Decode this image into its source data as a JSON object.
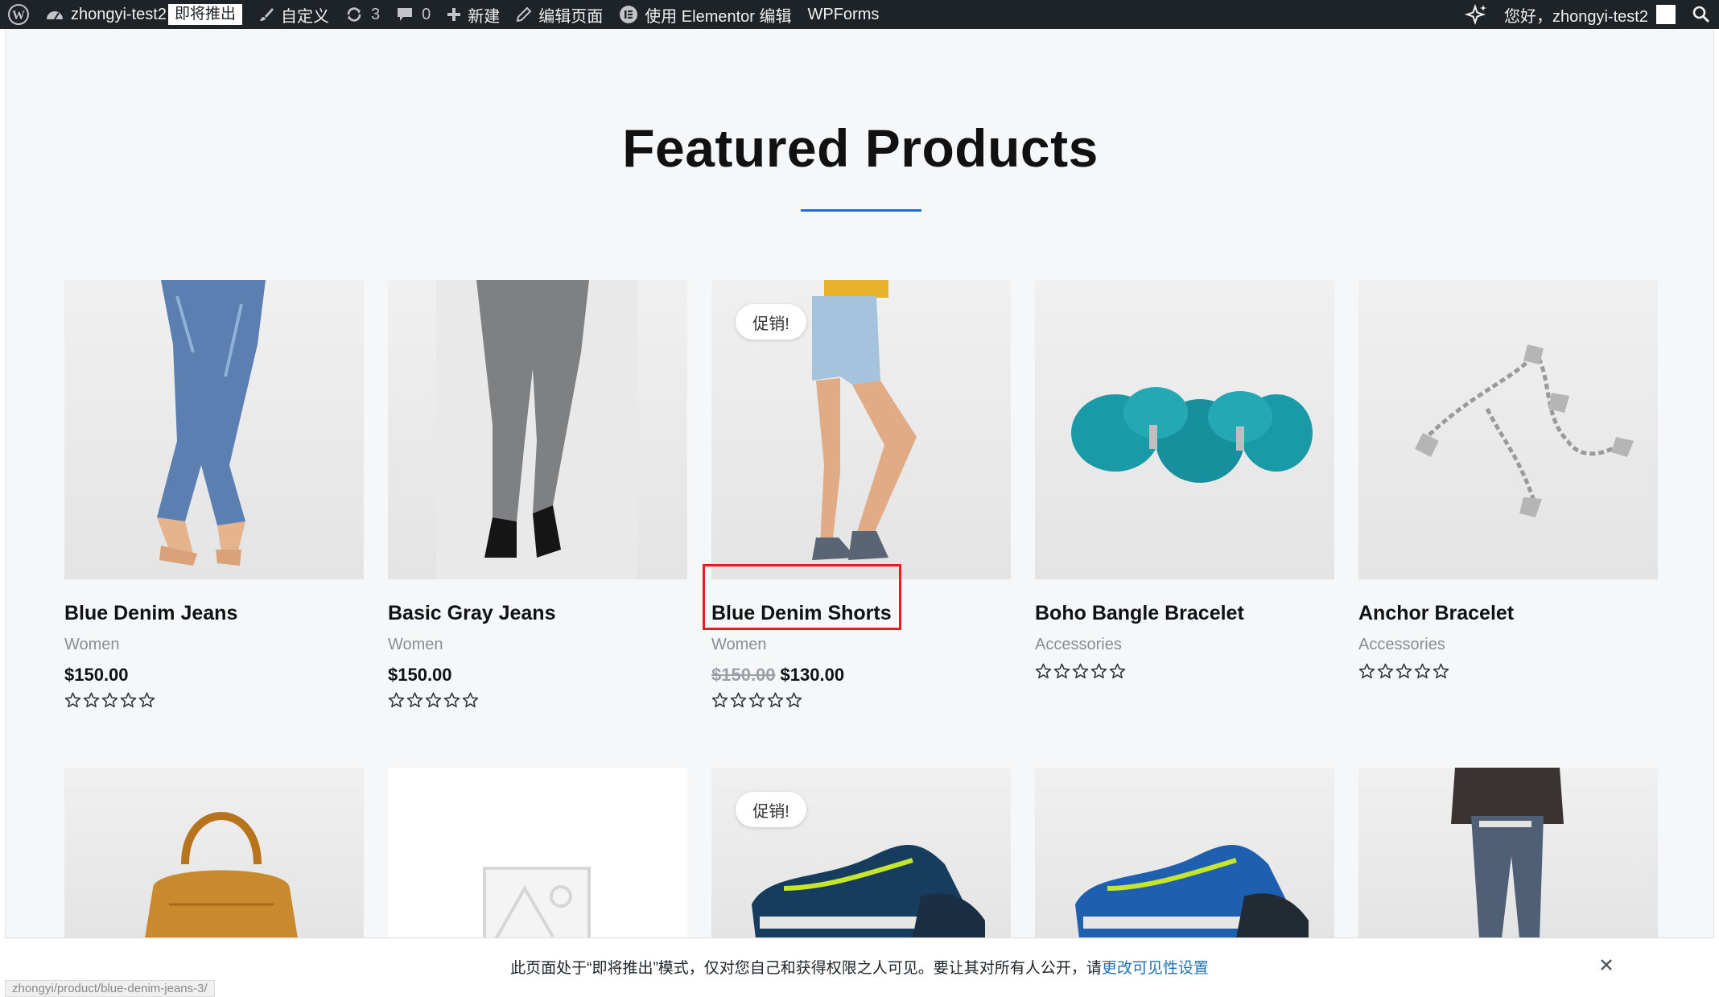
{
  "adminbar": {
    "wp_logo": "wordpress-logo-icon",
    "site_name": "zhongyi-test2",
    "launch_badge": "即将推出",
    "customize": "自定义",
    "updates_count": "3",
    "comments_count": "0",
    "new": "新建",
    "edit_page": "编辑页面",
    "elementor_edit": "使用 Elementor 编辑",
    "wpforms": "WPForms",
    "greeting": "您好，zhongyi-test2"
  },
  "main": {
    "heading": "Featured Products",
    "accent_color": "#1e6fd0",
    "sale_label": "促销!",
    "products_row1": [
      {
        "name": "Blue Denim Jeans",
        "category": "Women",
        "price": "$150.00",
        "old_price": "",
        "sale": false,
        "rating": 0
      },
      {
        "name": "Basic Gray Jeans",
        "category": "Women",
        "price": "$150.00",
        "old_price": "",
        "sale": false,
        "rating": 0
      },
      {
        "name": "Blue Denim Shorts",
        "category": "Women",
        "price": "$130.00",
        "old_price": "$150.00",
        "sale": true,
        "rating": 0
      },
      {
        "name": "Boho Bangle Bracelet",
        "category": "Accessories",
        "price": "",
        "old_price": "",
        "sale": false,
        "rating": 0
      },
      {
        "name": "Anchor Bracelet",
        "category": "Accessories",
        "price": "",
        "old_price": "",
        "sale": false,
        "rating": 0
      }
    ],
    "products_row2": [
      {
        "image": "leather-handbag",
        "sale": false
      },
      {
        "image": "placeholder-image",
        "sale": false
      },
      {
        "image": "sneaker",
        "sale": true
      },
      {
        "image": "sneaker",
        "sale": false
      },
      {
        "image": "jeans-man",
        "sale": false
      }
    ]
  },
  "notice": {
    "text": "此页面处于“即将推出”模式，仅对您自己和获得权限之人可见。要让其对所有人公开，请",
    "link": "更改可见性设置"
  },
  "status_url": "zhongyi/product/blue-denim-jeans-3/"
}
